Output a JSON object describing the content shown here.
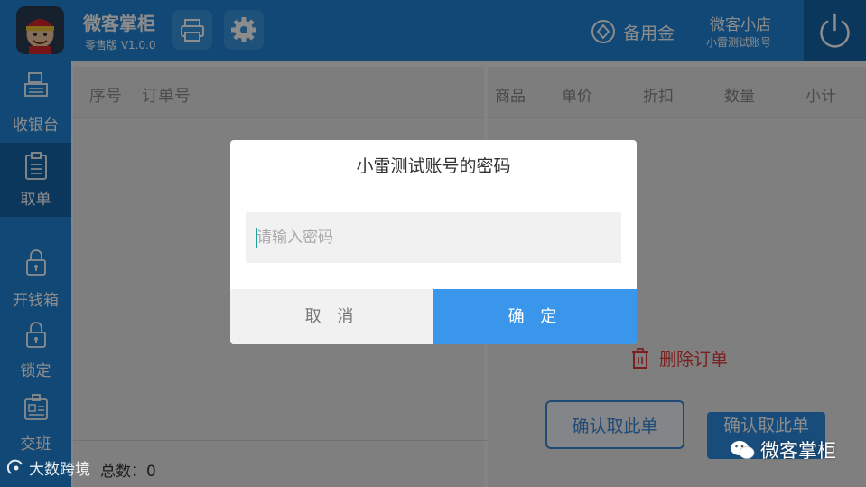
{
  "app": {
    "name": "微客掌柜",
    "version": "零售版 V1.0.0"
  },
  "topbar": {
    "petty_cash": "备用金",
    "store_name": "微客小店",
    "account": "小雷测试账号"
  },
  "sidebar": {
    "items": [
      {
        "label": "收银台",
        "icon": "cash-register-icon"
      },
      {
        "label": "取单",
        "icon": "clipboard-icon",
        "active": true
      },
      {
        "label": "开钱箱",
        "icon": "padlock-icon"
      },
      {
        "label": "锁定",
        "icon": "padlock-icon"
      },
      {
        "label": "交班",
        "icon": "id-card-icon"
      }
    ]
  },
  "orders_panel": {
    "col_seq": "序号",
    "col_order_no": "订单号",
    "total_label": "总数：0"
  },
  "items_panel": {
    "columns": [
      "商品",
      "单价",
      "折扣",
      "数量",
      "小计"
    ],
    "delete_label": "删除订单",
    "confirm_outline": "确认取此单",
    "confirm_solid": "确认取此单"
  },
  "dialog": {
    "title": "小雷测试账号的密码",
    "placeholder": "请输入密码",
    "value": "",
    "cancel": "取 消",
    "confirm": "确 定"
  },
  "watermarks": {
    "left": "大数跨境",
    "right": "微客掌柜"
  },
  "colors": {
    "primary": "#1f84d6",
    "primary_dark": "#1764a8",
    "accent": "#3996ea",
    "danger": "#e03a3a"
  }
}
